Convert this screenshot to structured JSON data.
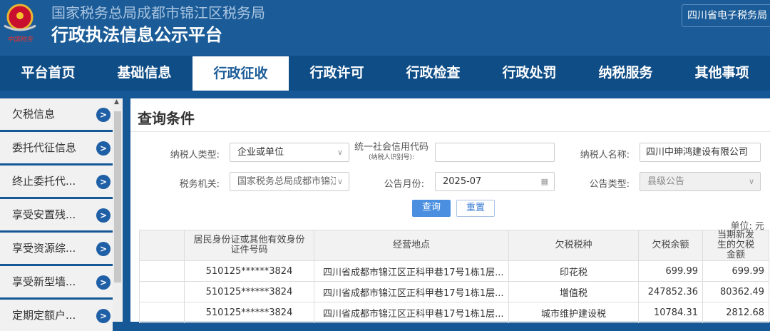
{
  "header": {
    "org": "国家税务总局成都市锦江区税务局",
    "title": "行政执法信息公示平台",
    "external_link": "四川省电子税务局",
    "logo_text": "中国税务"
  },
  "nav": [
    "平台首页",
    "基础信息",
    "行政征收",
    "行政许可",
    "行政检查",
    "行政处罚",
    "纳税服务",
    "其他事项"
  ],
  "sidebar": [
    "欠税信息",
    "委托代征信息",
    "终止委托代...",
    "享受安置残...",
    "享受资源综...",
    "享受新型墙...",
    "定期定额户..."
  ],
  "query": {
    "title": "查询条件",
    "taxpayer_type_label": "纳税人类型:",
    "taxpayer_type": "企业或单位",
    "credit_code_label": "统一社会信用代码",
    "credit_code_sub": "(纳税人识别号):",
    "credit_code": "",
    "name_label": "纳税人名称:",
    "name": "四川中珅鸿建设有限公司",
    "authority_label": "税务机关:",
    "authority": "国家税务总局成都市锦江",
    "month_label": "公告月份:",
    "month": "2025-07",
    "notice_type_label": "公告类型:",
    "notice_type": "县级公告",
    "search": "查询",
    "reset": "重置",
    "unit": "单位: 元"
  },
  "table": {
    "headers": [
      "",
      "居民身份证或其他有效身份证件号码",
      "经营地点",
      "欠税税种",
      "欠税余额",
      "当期新发生的欠税金额"
    ],
    "rows": [
      [
        "",
        "510125******3824",
        "四川省成都市锦江区正科甲巷17号1栋1层...",
        "印花税",
        "699.99",
        "699.99"
      ],
      [
        "",
        "510125******3824",
        "四川省成都市锦江区正科甲巷17号1栋1层...",
        "增值税",
        "247852.36",
        "80362.49"
      ],
      [
        "",
        "510125******3824",
        "四川省成都市锦江区正科甲巷17号1栋1层...",
        "城市维护建设税",
        "10784.31",
        "2812.68"
      ]
    ]
  }
}
